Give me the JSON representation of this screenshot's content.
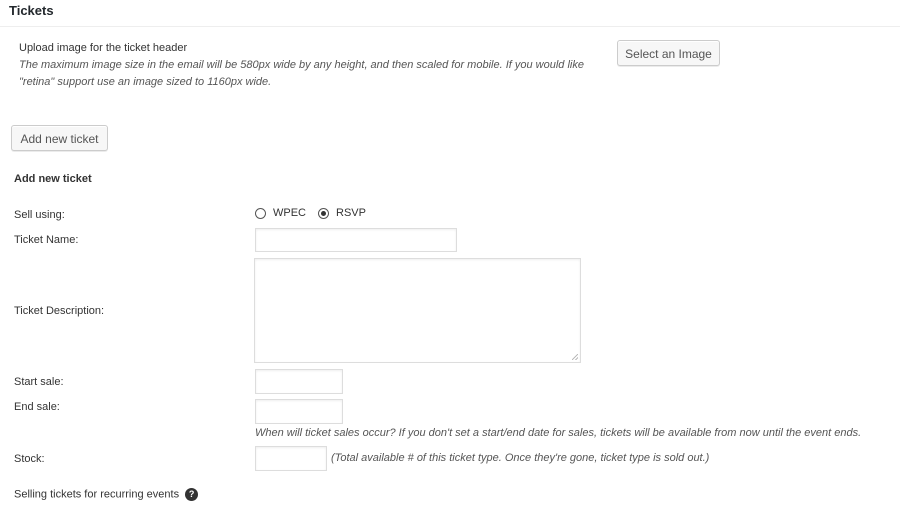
{
  "section_title": "Tickets",
  "header_image": {
    "label": "Upload image for the ticket header",
    "note": "The maximum image size in the email will be 580px wide by any height, and then scaled for mobile. If you would like \"retina\" support use an image sized to 1160px wide.",
    "button_label": "Select an Image"
  },
  "add_ticket_button": "Add new ticket",
  "form": {
    "heading": "Add new ticket",
    "sell_using": {
      "label": "Sell using:",
      "options": [
        "WPEC",
        "RSVP"
      ],
      "selected": "RSVP"
    },
    "ticket_name": {
      "label": "Ticket Name:",
      "value": ""
    },
    "ticket_description": {
      "label": "Ticket Description:",
      "value": ""
    },
    "start_sale": {
      "label": "Start sale:",
      "value": ""
    },
    "end_sale": {
      "label": "End sale:",
      "value": ""
    },
    "sale_dates_hint": "When will ticket sales occur? If you don't set a start/end date for sales, tickets will be available from now until the event ends.",
    "stock": {
      "label": "Stock:",
      "value": "",
      "hint": "(Total available # of this ticket type. Once they're gone, ticket type is sold out.)"
    },
    "recurring": {
      "label": "Selling tickets for recurring events"
    }
  }
}
